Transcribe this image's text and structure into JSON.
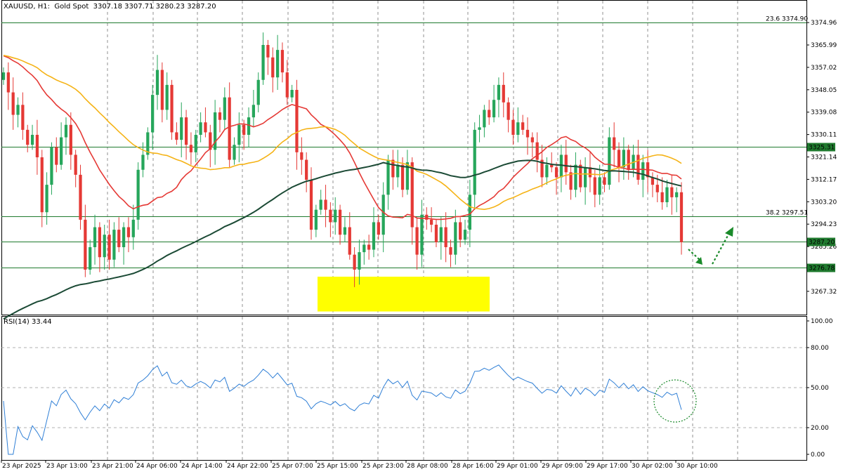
{
  "header": {
    "symbol_text": "XAUUSD, H1:  Gold Spot  3307.18 3307.71 3280.23 3287.20"
  },
  "rsi_header": "RSI(14) 33.44",
  "colors": {
    "bull": "#26a65b",
    "bear": "#e53935",
    "ma_fast": "#e53935",
    "ma_mid": "#f5b316",
    "ma_slow": "#1b4a35",
    "level": "#1f7a2e",
    "zone": "#ffff00",
    "rsi": "#2f7fd6",
    "arrow": "#1a8a2a"
  },
  "chart_data": [
    {
      "type": "candlestick",
      "title": "XAUUSD, H1: Gold Spot",
      "ylim": [
        3258,
        3384
      ],
      "y_ticks": [
        3374.96,
        3365.99,
        3357.02,
        3348.05,
        3339.08,
        3330.11,
        3321.14,
        3312.17,
        3303.2,
        3294.23,
        3285.26,
        3267.32
      ],
      "x_labels": [
        "23 Apr 2025",
        "23 Apr 13:00",
        "23 Apr 21:00",
        "24 Apr 06:00",
        "24 Apr 14:00",
        "24 Apr 22:00",
        "25 Apr 07:00",
        "25 Apr 15:00",
        "25 Apr 23:00",
        "28 Apr 08:00",
        "28 Apr 16:00",
        "29 Apr 01:00",
        "29 Apr 09:00",
        "29 Apr 17:00",
        "30 Apr 02:00",
        "30 Apr 10:00"
      ],
      "levels": [
        {
          "label": "23.6 3374.90",
          "value": 3374.9
        },
        {
          "label": "3325.31",
          "value": 3325.31,
          "tag": true
        },
        {
          "label": "38.2 3297.51",
          "value": 3297.51
        },
        {
          "label": "3287.20",
          "value": 3287.2,
          "tag": true
        },
        {
          "label": "3276.78",
          "value": 3276.78,
          "tag": true
        }
      ],
      "support_zone": {
        "from": 3266.0,
        "to": 3276.0
      },
      "closes": [
        3355,
        3347,
        3338,
        3342,
        3332,
        3326,
        3330,
        3321,
        3299,
        3310,
        3325,
        3318,
        3329,
        3334,
        3322,
        3314,
        3296,
        3276,
        3285,
        3293,
        3281,
        3290,
        3280,
        3292,
        3285,
        3293,
        3289,
        3296,
        3316,
        3322,
        3331,
        3346,
        3356,
        3340,
        3350,
        3331,
        3328,
        3337,
        3326,
        3323,
        3330,
        3335,
        3331,
        3324,
        3339,
        3336,
        3345,
        3320,
        3326,
        3334,
        3330,
        3337,
        3342,
        3352,
        3366,
        3361,
        3353,
        3364,
        3355,
        3345,
        3348,
        3323,
        3320,
        3312,
        3292,
        3300,
        3304,
        3300,
        3295,
        3300,
        3290,
        3293,
        3282,
        3276,
        3283,
        3286,
        3284,
        3295,
        3290,
        3306,
        3320,
        3313,
        3318,
        3308,
        3319,
        3293,
        3282,
        3298,
        3296,
        3294,
        3287,
        3293,
        3285,
        3282,
        3295,
        3288,
        3292,
        3306,
        3332,
        3333,
        3340,
        3337,
        3344,
        3350,
        3343,
        3336,
        3330,
        3335,
        3332,
        3329,
        3327,
        3320,
        3313,
        3318,
        3317,
        3313,
        3322,
        3315,
        3308,
        3318,
        3309,
        3317,
        3313,
        3306,
        3313,
        3310,
        3329,
        3324,
        3317,
        3324,
        3316,
        3322,
        3312,
        3319,
        3313,
        3310,
        3307,
        3303,
        3309,
        3305,
        3307,
        3287
      ]
    },
    {
      "type": "line",
      "title": "RSI(14)",
      "ylim": [
        0,
        100
      ],
      "y_ticks": [
        100,
        80,
        50,
        20,
        0
      ],
      "y_tick_labels": [
        "100.00",
        "80.00",
        "50.00",
        "20.00",
        "0.00"
      ],
      "levels": [
        80,
        50,
        20
      ],
      "last_value": 33.44
    }
  ],
  "annotations": {
    "arrow_down": "down-arrow",
    "arrow_up": "up-arrow",
    "circle": "rsi-highlight-circle"
  }
}
